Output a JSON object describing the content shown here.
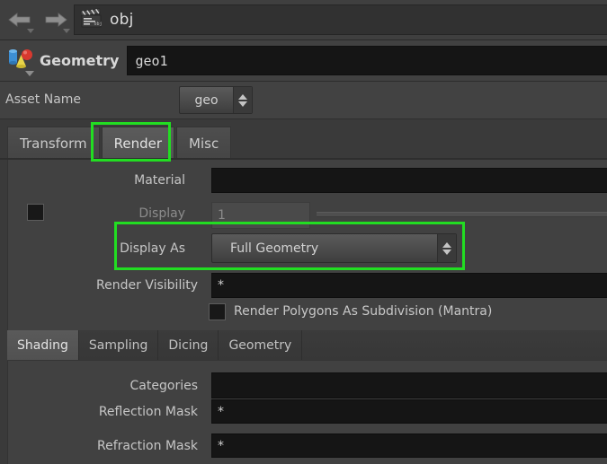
{
  "pathbar": {
    "back_icon": "arrow-left-icon",
    "forward_icon": "arrow-right-icon",
    "node_icon": "clapperboard-icon",
    "path": "obj"
  },
  "node_header": {
    "type_icon": "geometry-primitives-icon",
    "type_label": "Geometry",
    "node_name": "geo1"
  },
  "asset_row": {
    "label": "Asset Name",
    "value": "geo"
  },
  "tabs": [
    {
      "label": "Transform",
      "active": false
    },
    {
      "label": "Render",
      "active": true
    },
    {
      "label": "Misc",
      "active": false
    }
  ],
  "parameters": {
    "material": {
      "label": "Material",
      "value": ""
    },
    "display": {
      "label": "Display",
      "value": "1",
      "disabled": true,
      "checkbox_checked": false
    },
    "display_as": {
      "label": "Display As",
      "value": "Full Geometry"
    },
    "render_visibility": {
      "label": "Render Visibility",
      "value": "*"
    },
    "render_subdiv": {
      "label": "Render Polygons As Subdivision (Mantra)",
      "checked": false
    },
    "categories": {
      "label": "Categories",
      "value": ""
    },
    "reflection_mask": {
      "label": "Reflection Mask",
      "value": "*"
    },
    "refraction_mask": {
      "label": "Refraction Mask",
      "value": "*"
    }
  },
  "subtabs": [
    {
      "label": "Shading",
      "active": true
    },
    {
      "label": "Sampling",
      "active": false
    },
    {
      "label": "Dicing",
      "active": false
    },
    {
      "label": "Geometry",
      "active": false
    }
  ],
  "highlights": {
    "accent_color": "#22dd22",
    "render_tab": "Render",
    "display_as_row": "Display As"
  }
}
